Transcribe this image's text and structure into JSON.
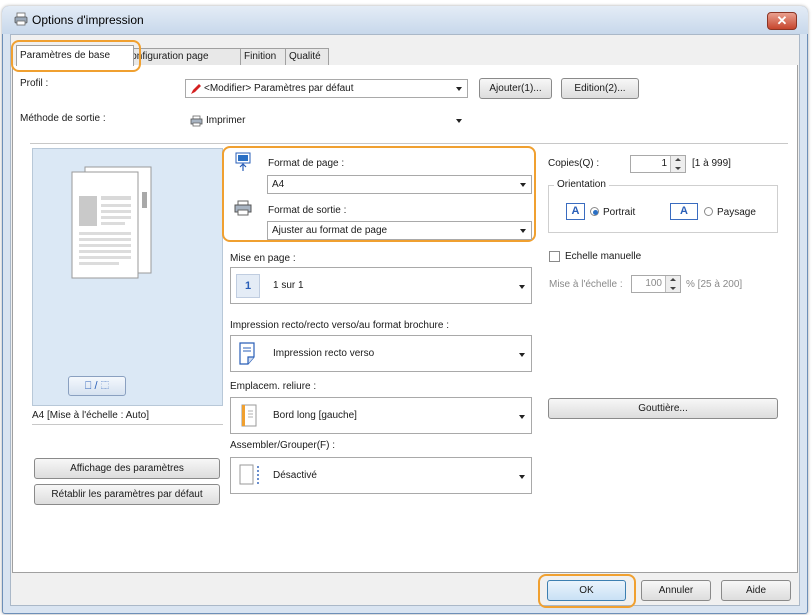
{
  "window": {
    "title": "Options d'impression",
    "close_label": "✕"
  },
  "tabs": [
    {
      "label": "Paramètres de base"
    },
    {
      "label": "Configuration page"
    },
    {
      "label": "Finition"
    },
    {
      "label": "Qualité"
    }
  ],
  "profile": {
    "label": "Profil :",
    "value": "<Modifier> Paramètres par défaut",
    "add_button": "Ajouter(1)...",
    "edit_button": "Edition(2)..."
  },
  "output_method": {
    "label": "Méthode de sortie :",
    "value": "Imprimer"
  },
  "preview": {
    "toggle_label": "⎕ / ⬚",
    "caption": "A4 [Mise à l'échelle : Auto]"
  },
  "left_buttons": {
    "show_settings": "Affichage des paramètres",
    "restore_defaults": "Rétablir les paramètres par défaut"
  },
  "page_size": {
    "label": "Format de page :",
    "value": "A4"
  },
  "output_size": {
    "label": "Format de sortie :",
    "value": "Ajuster au format de page"
  },
  "layout": {
    "label": "Mise en page :",
    "icon_text": "1",
    "value": "1 sur 1"
  },
  "duplex": {
    "label": "Impression recto/recto verso/au format brochure :",
    "value": "Impression recto verso"
  },
  "binding": {
    "label": "Emplacem. reliure :",
    "value": "Bord long [gauche]"
  },
  "collate": {
    "label": "Assembler/Grouper(F) :",
    "value": "Désactivé"
  },
  "copies": {
    "label": "Copies(Q) :",
    "value": "1",
    "range": "[1 à 999]"
  },
  "orientation": {
    "label": "Orientation",
    "a_icon": "A",
    "portrait": "Portrait",
    "landscape": "Paysage",
    "selected": "Portrait"
  },
  "manual_scaling": {
    "label": "Echelle manuelle",
    "scale_label": "Mise à l'échelle :",
    "value": "100",
    "range": "% [25 à 200]"
  },
  "gutter_button": "Gouttière...",
  "footer": {
    "ok": "OK",
    "cancel": "Annuler",
    "help": "Aide"
  },
  "colors": {
    "highlight": "#f0a030",
    "accent": "#2a6fc4"
  }
}
